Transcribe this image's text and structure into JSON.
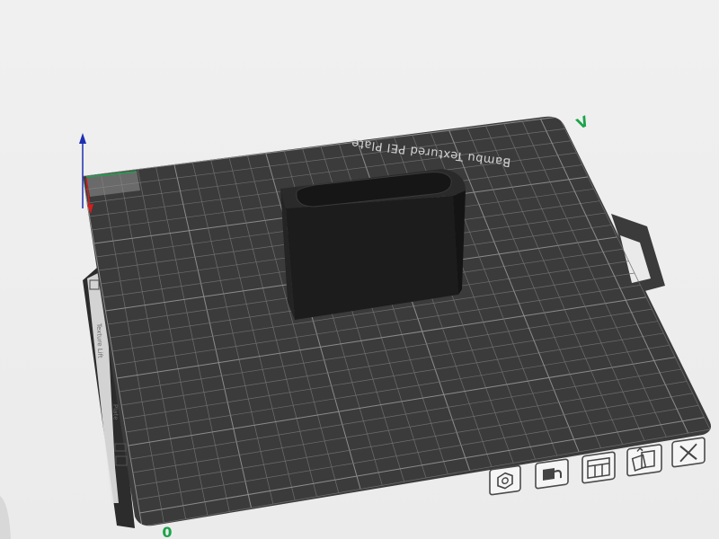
{
  "plate": {
    "name": "Bambu Textured PEI Plate",
    "index_label": "0"
  },
  "axes": {
    "y_marker": "V"
  },
  "side_panel": {
    "text_lines": [
      "Texture Lift",
      "Plate"
    ]
  },
  "toolbar": {
    "buttons": [
      {
        "id": "orient",
        "icon": "hexagon-nut-icon"
      },
      {
        "id": "lock",
        "icon": "lock-icon"
      },
      {
        "id": "arrange",
        "icon": "arrange-grid-icon"
      },
      {
        "id": "settings",
        "icon": "plate-settings-icon"
      },
      {
        "id": "close",
        "icon": "close-icon"
      }
    ]
  },
  "colors": {
    "plate": "#3b3b3b",
    "grid": "#6e6e6e",
    "object": "#1c1c1c",
    "x_axis": "#d31e1e",
    "y_axis": "#1aa34a",
    "z_axis": "#1e2fb0"
  }
}
